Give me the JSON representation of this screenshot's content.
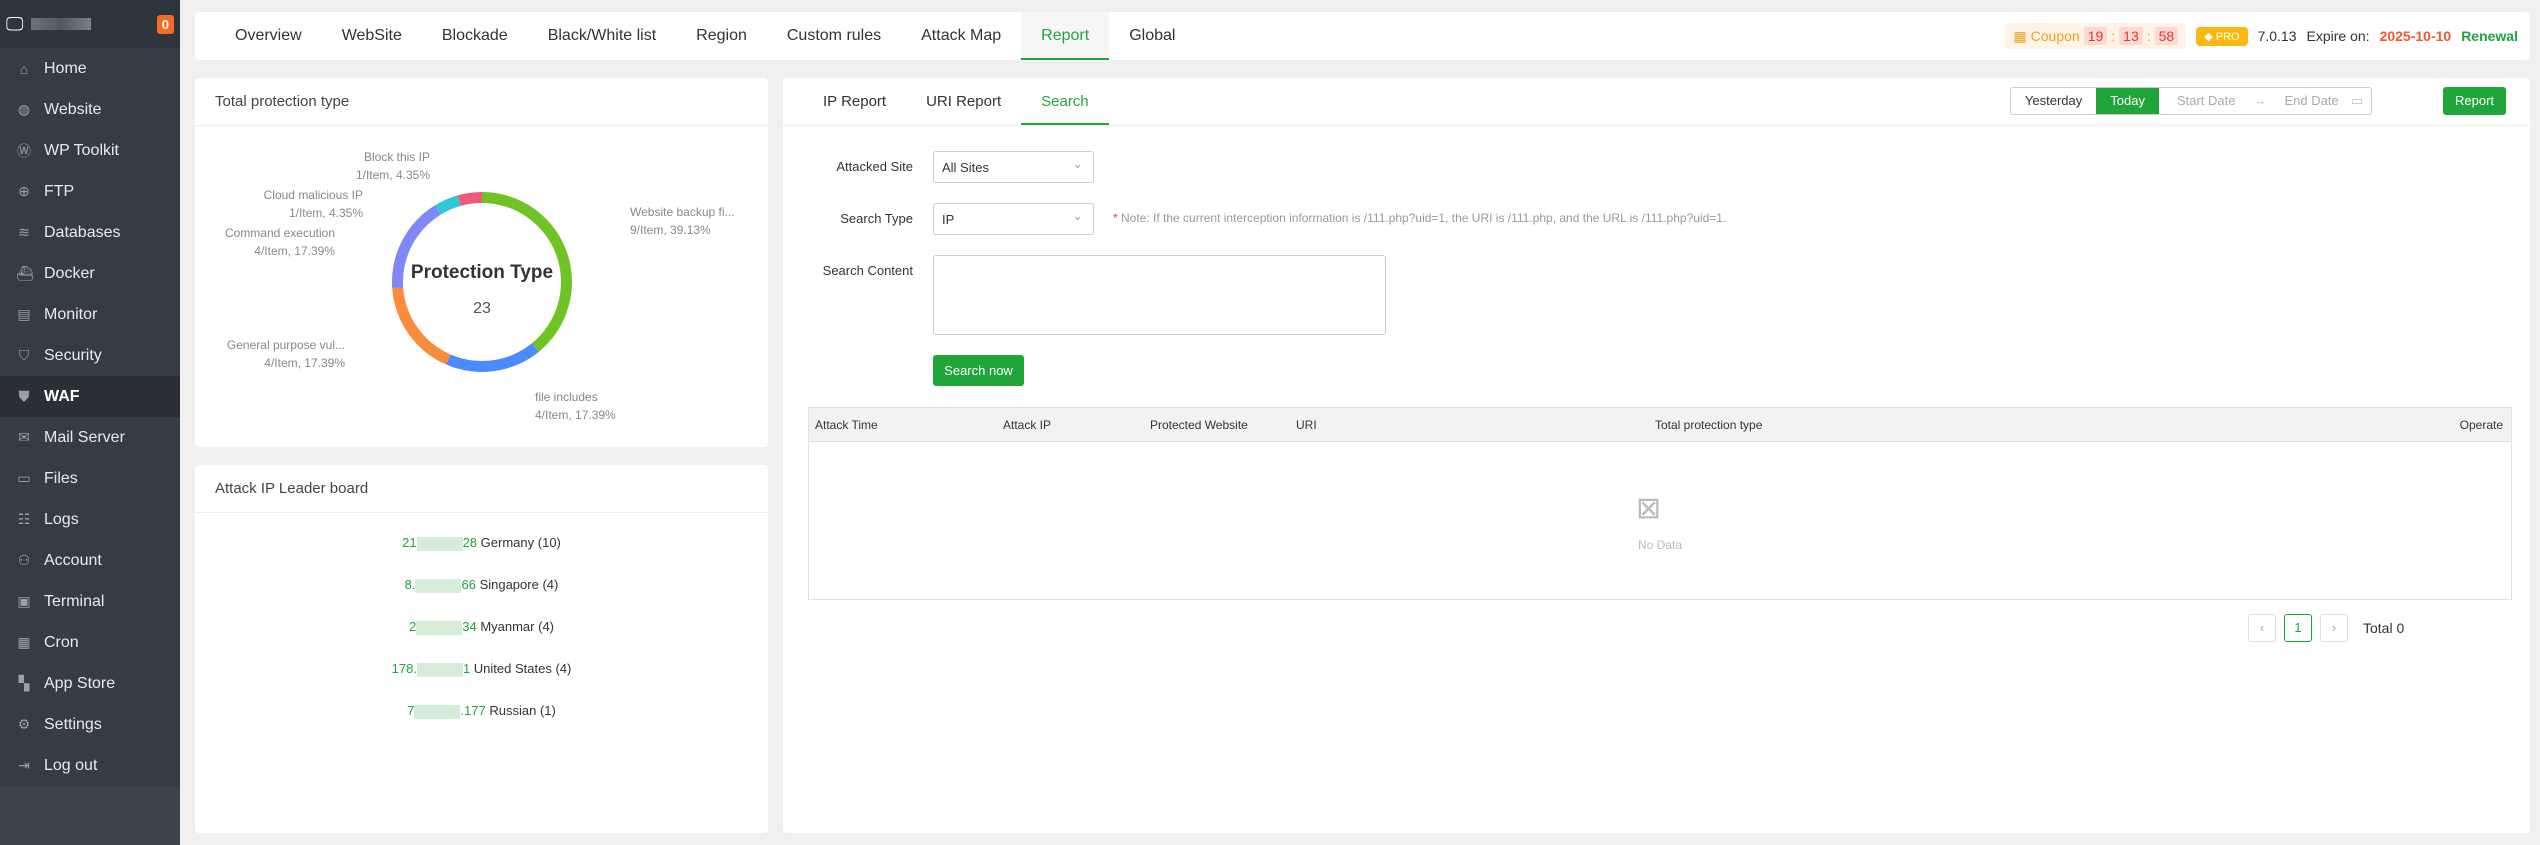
{
  "sidebar": {
    "badge": "0",
    "items": [
      {
        "label": "Home",
        "icon": "⌂"
      },
      {
        "label": "Website",
        "icon": "◍"
      },
      {
        "label": "WP Toolkit",
        "icon": "Ⓦ"
      },
      {
        "label": "FTP",
        "icon": "⊕"
      },
      {
        "label": "Databases",
        "icon": "≋"
      },
      {
        "label": "Docker",
        "icon": "⛴"
      },
      {
        "label": "Monitor",
        "icon": "▤"
      },
      {
        "label": "Security",
        "icon": "⛉"
      },
      {
        "label": "WAF",
        "icon": "⛊"
      },
      {
        "label": "Mail Server",
        "icon": "✉"
      },
      {
        "label": "Files",
        "icon": "▭"
      },
      {
        "label": "Logs",
        "icon": "☷"
      },
      {
        "label": "Account",
        "icon": "⚇"
      },
      {
        "label": "Terminal",
        "icon": "▣"
      },
      {
        "label": "Cron",
        "icon": "▦"
      },
      {
        "label": "App Store",
        "icon": "▚"
      },
      {
        "label": "Settings",
        "icon": "⚙"
      },
      {
        "label": "Log out",
        "icon": "⇥"
      }
    ]
  },
  "topnav": {
    "tabs": [
      "Overview",
      "WebSite",
      "Blockade",
      "Black/White list",
      "Region",
      "Custom rules",
      "Attack Map",
      "Report",
      "Global"
    ],
    "coupon": "Coupon",
    "countdown": [
      "19",
      "13",
      "58"
    ],
    "pro": "PRO",
    "version": "7.0.13",
    "expire_label": "Expire on:",
    "expire_date": "2025-10-10",
    "renewal": "Renewal"
  },
  "protection": {
    "title": "Total protection type",
    "center_title": "Protection Type",
    "center_total": "23"
  },
  "chart_data": {
    "type": "pie",
    "title": "Protection Type",
    "total": 23,
    "slices": [
      {
        "name": "Website backup fi...",
        "value": 9,
        "label": "9/Item, 39.13%",
        "color": "#6ec423"
      },
      {
        "name": "file includes",
        "value": 4,
        "label": "4/Item, 17.39%",
        "color": "#4b8bff"
      },
      {
        "name": "General purpose vul...",
        "value": 4,
        "label": "4/Item, 17.39%",
        "color": "#fb8c3c"
      },
      {
        "name": "Command execution",
        "value": 4,
        "label": "4/Item, 17.39%",
        "color": "#8087f9"
      },
      {
        "name": "Cloud malicious IP",
        "value": 1,
        "label": "1/Item, 4.35%",
        "color": "#30c7d9"
      },
      {
        "name": "Block this IP",
        "value": 1,
        "label": "1/Item, 4.35%",
        "color": "#ef5a7b"
      }
    ]
  },
  "leaderboard": {
    "title": "Attack IP Leader board",
    "rows": [
      {
        "ip_start": "21",
        "ip_end": "28",
        "country": "Germany",
        "count": "(10)"
      },
      {
        "ip_start": "8.",
        "ip_end": "66",
        "country": "Singapore",
        "count": "(4)"
      },
      {
        "ip_start": "2",
        "ip_end": "34",
        "country": "Myanmar",
        "count": "(4)"
      },
      {
        "ip_start": "178.",
        "ip_end": "1",
        "country": "United States",
        "count": "(4)"
      },
      {
        "ip_start": "7",
        "ip_end": ".177",
        "country": "Russian",
        "count": "(1)"
      }
    ]
  },
  "report": {
    "tabs": [
      "IP Report",
      "URI Report",
      "Search"
    ],
    "yesterday": "Yesterday",
    "today": "Today",
    "start_date": "Start Date",
    "end_date": "End Date",
    "report_btn": "Report",
    "attacked_site_label": "Attacked Site",
    "attacked_site_value": "All Sites",
    "search_type_label": "Search Type",
    "search_type_value": "IP",
    "note": "Note: If the current interception information is /111.php?uid=1, the URI is /111.php, and the URL is /111.php?uid=1.",
    "search_content_label": "Search Content",
    "search_btn": "Search now",
    "columns": [
      "Attack Time",
      "Attack IP",
      "Protected Website",
      "URI",
      "Total protection type",
      "Operate"
    ],
    "no_data": "No Data",
    "page": "1",
    "total": "Total 0"
  }
}
